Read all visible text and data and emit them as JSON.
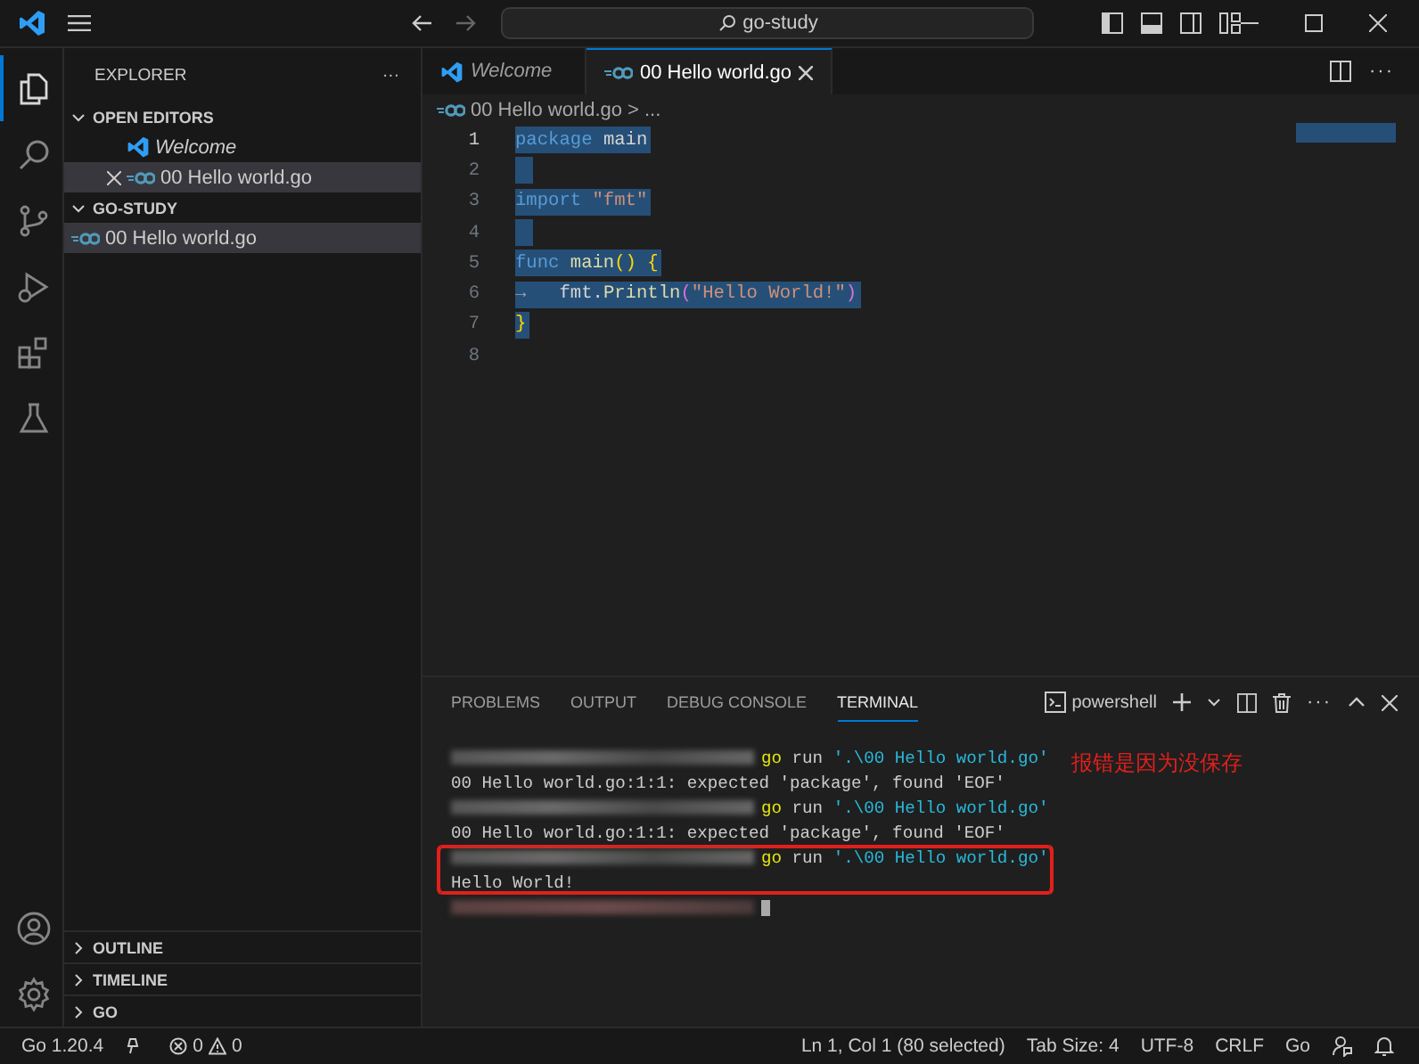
{
  "title_bar": {
    "search": "go-study"
  },
  "activity_bar": [
    {
      "kind": "files",
      "selected": true
    },
    {
      "kind": "search",
      "selected": false
    },
    {
      "kind": "source-control",
      "selected": false
    },
    {
      "kind": "debug",
      "selected": false
    },
    {
      "kind": "extensions",
      "selected": false
    },
    {
      "kind": "testing",
      "selected": false
    }
  ],
  "sidebar": {
    "title": "EXPLORER",
    "more": "···",
    "sections": [
      {
        "title": "OPEN EDITORS",
        "expanded": true,
        "items": [
          {
            "label": "Welcome",
            "kind": "welcome",
            "italic": true,
            "selected": false,
            "close": false
          },
          {
            "label": "00 Hello world.go",
            "kind": "go",
            "italic": false,
            "selected": true,
            "close": true
          }
        ]
      },
      {
        "title": "GO-STUDY",
        "expanded": true,
        "items": [
          {
            "label": "00 Hello world.go",
            "kind": "go",
            "italic": false,
            "selected": true,
            "close": false
          }
        ]
      }
    ],
    "bottom_sections": [
      {
        "title": "OUTLINE",
        "expanded": false
      },
      {
        "title": "TIMELINE",
        "expanded": false
      },
      {
        "title": "GO",
        "expanded": false
      }
    ]
  },
  "editor_tabs": [
    {
      "label": "Welcome",
      "kind": "welcome",
      "italic": true,
      "selected": false
    },
    {
      "label": "00 Hello world.go",
      "kind": "go",
      "italic": false,
      "selected": true
    }
  ],
  "breadcrumb": {
    "file": "00 Hello world.go",
    "rest": "> ..."
  },
  "code": [
    {
      "number": "1",
      "active": true,
      "selected": true,
      "tokens": [
        {
          "kind": "keyword",
          "text": "package"
        },
        {
          "kind": "plain",
          "text": " main"
        }
      ]
    },
    {
      "number": "2",
      "active": false,
      "selected": true
    },
    {
      "number": "3",
      "active": false,
      "selected": true,
      "tokens": [
        {
          "kind": "keyword",
          "text": "import"
        },
        {
          "kind": "string",
          "text": " \"fmt\""
        }
      ]
    },
    {
      "number": "4",
      "active": false,
      "selected": true
    },
    {
      "number": "5",
      "active": false,
      "selected": true,
      "tokens": [
        {
          "kind": "keyword",
          "text": "func"
        },
        {
          "kind": "function",
          "text": " main"
        },
        {
          "kind": "bracket",
          "text": "() {"
        }
      ]
    },
    {
      "number": "6",
      "active": false,
      "selected": true,
      "tokens": [
        {
          "kind": "whitespace",
          "text": "→   "
        },
        {
          "kind": "plain",
          "text": "fmt."
        },
        {
          "kind": "function",
          "text": "Println"
        },
        {
          "kind": "bracket2",
          "text": "("
        },
        {
          "kind": "string",
          "text": "\"Hello World!\""
        },
        {
          "kind": "bracket2",
          "text": ")"
        }
      ]
    },
    {
      "number": "7",
      "active": false,
      "selected": true,
      "tokens": [
        {
          "kind": "bracket",
          "text": "}"
        }
      ]
    },
    {
      "number": "8",
      "active": false,
      "selected": false
    }
  ],
  "panel_tabs": [
    {
      "label": "PROBLEMS",
      "selected": false
    },
    {
      "label": "OUTPUT",
      "selected": false
    },
    {
      "label": "DEBUG CONSOLE",
      "selected": false
    },
    {
      "label": "TERMINAL",
      "selected": true
    }
  ],
  "terminal_profile": "powershell",
  "terminal": [
    {
      "kind": "command",
      "cmd": "go",
      "args": " run ",
      "path": "'.\\00 Hello world.go'",
      "boxed": false
    },
    {
      "kind": "output",
      "text": "00 Hello world.go:1:1: expected 'package', found 'EOF'",
      "boxed": false
    },
    {
      "kind": "command",
      "cmd": "go",
      "args": " run ",
      "path": "'.\\00 Hello world.go'",
      "boxed": false
    },
    {
      "kind": "output",
      "text": "00 Hello world.go:1:1: expected 'package', found 'EOF'",
      "boxed": false
    },
    {
      "kind": "command",
      "cmd": "go",
      "args": " run ",
      "path": "'.\\00 Hello world.go'",
      "boxed": true
    },
    {
      "kind": "output",
      "text": "Hello World!",
      "boxed": true
    },
    {
      "kind": "prompt",
      "boxed": false
    }
  ],
  "annotation": "报错是因为没保存",
  "status_bar": {
    "go_version": "Go 1.20.4",
    "errors": "0",
    "warnings": "0",
    "right": [
      "Ln 1, Col 1 (80 selected)",
      "Tab Size: 4",
      "UTF-8",
      "CRLF",
      "Go"
    ]
  }
}
